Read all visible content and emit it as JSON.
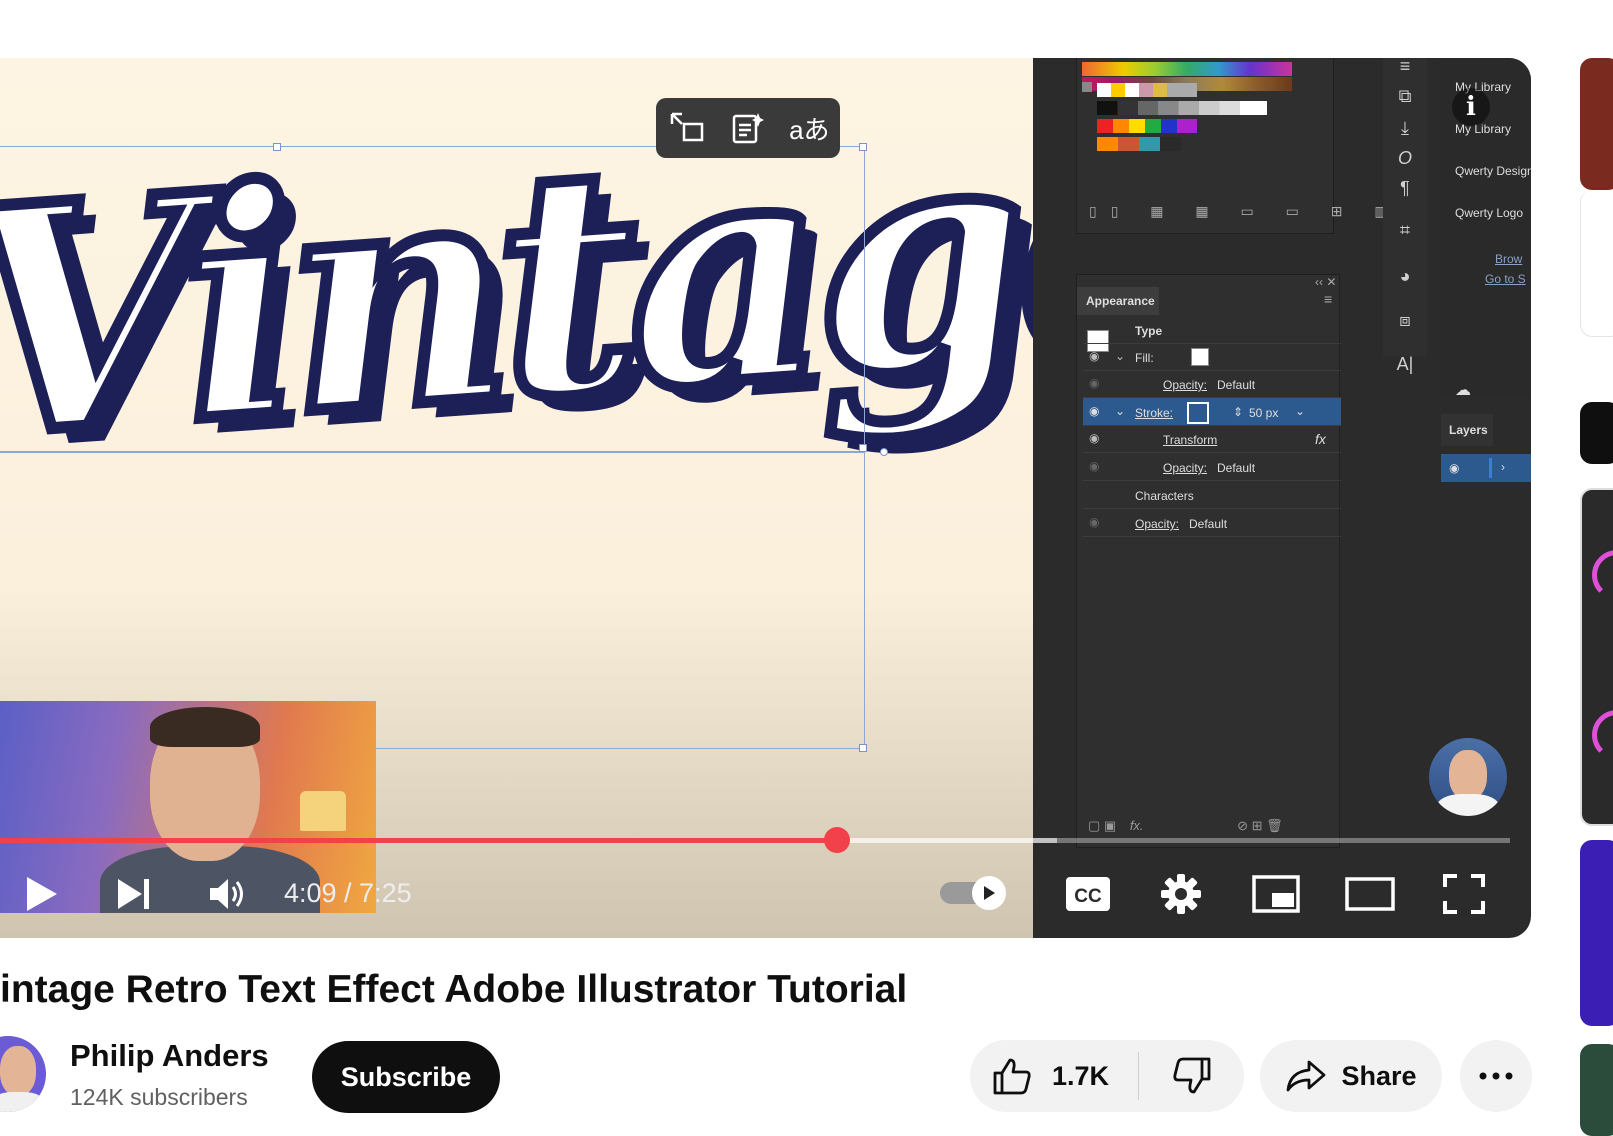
{
  "video": {
    "title": "intage Retro Text Effect Adobe Illustrator Tutorial",
    "artwork_text": "Vintage",
    "time_display": "4:09 / 7:25",
    "progress": {
      "played": 0.554,
      "buffered": 0.7
    },
    "overlay_toolbar": [
      "fit-icon",
      "document-sparkle-icon",
      "translate-icon"
    ],
    "overlay_translate_glyph": "aあ"
  },
  "illustrator": {
    "appearance_panel": {
      "title": "Appearance",
      "rows": [
        {
          "label": "Type"
        },
        {
          "label": "Fill:"
        },
        {
          "label": "Opacity:",
          "value": "Default"
        },
        {
          "label": "Stroke:",
          "value": "50 px"
        },
        {
          "label": "Transform",
          "fx": "fx"
        },
        {
          "label": "Opacity:",
          "value": "Default"
        },
        {
          "label": "Characters"
        },
        {
          "label": "Opacity:",
          "value": "Default"
        }
      ],
      "footer_fx": "fx."
    },
    "libraries": [
      "My Library",
      "My Library",
      "Qwerty Design",
      "Qwerty Logo"
    ],
    "library_links": [
      "Brow",
      "Go to S"
    ],
    "layers_tab": "Layers",
    "type_tool": "A|"
  },
  "channel": {
    "name": "Philip Anders",
    "subscribers": "124K subscribers",
    "subscribe_label": "Subscribe"
  },
  "actions": {
    "likes": "1.7K",
    "share_label": "Share"
  },
  "colors": {
    "progress": "#f2414a",
    "artwork_stroke": "#1d1f57",
    "canvas_bg": "#fdf4e3",
    "panel_bg": "#2b2b2b",
    "selection_row": "#2d5a8e"
  }
}
